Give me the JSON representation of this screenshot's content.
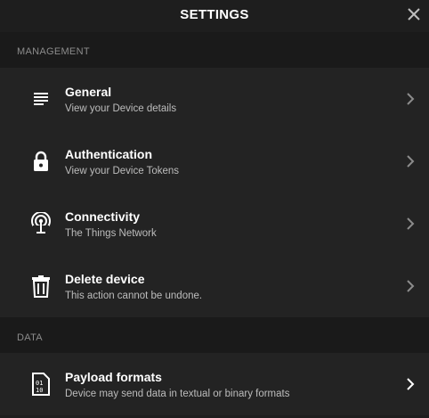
{
  "header": {
    "title": "SETTINGS"
  },
  "sections": [
    {
      "label": "MANAGEMENT",
      "items": [
        {
          "title": "General",
          "subtitle": "View your Device details",
          "icon": "list-icon"
        },
        {
          "title": "Authentication",
          "subtitle": "View your Device Tokens",
          "icon": "lock-icon"
        },
        {
          "title": "Connectivity",
          "subtitle": "The Things Network",
          "icon": "antenna-icon"
        },
        {
          "title": "Delete device",
          "subtitle": "This action cannot be undone.",
          "icon": "trash-icon"
        }
      ]
    },
    {
      "label": "DATA",
      "items": [
        {
          "title": "Payload formats",
          "subtitle": "Device may send data in textual or binary formats",
          "icon": "binary-file-icon"
        }
      ]
    }
  ],
  "colors": {
    "background": "#1e1e1e",
    "list_background": "#232323",
    "section_label": "#8c8c8c",
    "subtitle": "#bdbdbd"
  }
}
